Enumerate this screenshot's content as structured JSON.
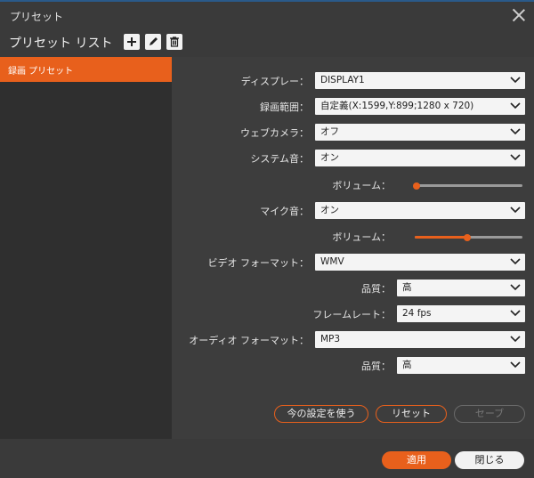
{
  "window": {
    "title": "プリセット"
  },
  "toolbar": {
    "list_title": "プリセット リスト"
  },
  "sidebar": {
    "items": [
      {
        "label": "録画 プリセット"
      }
    ]
  },
  "form": {
    "display": {
      "label": "ディスプレー：",
      "value": "DISPLAY1"
    },
    "range": {
      "label": "録画範囲：",
      "value": "自定義(X:1599,Y:899;1280 x 720)"
    },
    "webcam": {
      "label": "ウェブカメラ：",
      "value": "オフ"
    },
    "system_audio": {
      "label": "システム音：",
      "value": "オン"
    },
    "system_volume": {
      "label": "ボリューム：",
      "level": 0
    },
    "mic": {
      "label": "マイク音：",
      "value": "オン"
    },
    "mic_volume": {
      "label": "ボリューム：",
      "level": 0.47
    },
    "video_format": {
      "label": "ビデオ フォーマット：",
      "value": "WMV"
    },
    "video_quality": {
      "label": "品質：",
      "value": "高"
    },
    "frame_rate": {
      "label": "フレームレート：",
      "value": "24 fps"
    },
    "audio_format": {
      "label": "オーディオ フォーマット：",
      "value": "MP3"
    },
    "audio_quality": {
      "label": "品質：",
      "value": "高"
    }
  },
  "actions": {
    "use_current": "今の設定を使う",
    "reset": "リセット",
    "save": "セーブ"
  },
  "footer": {
    "apply": "適用",
    "close": "閉じる"
  },
  "colors": {
    "accent": "#e8601c"
  }
}
